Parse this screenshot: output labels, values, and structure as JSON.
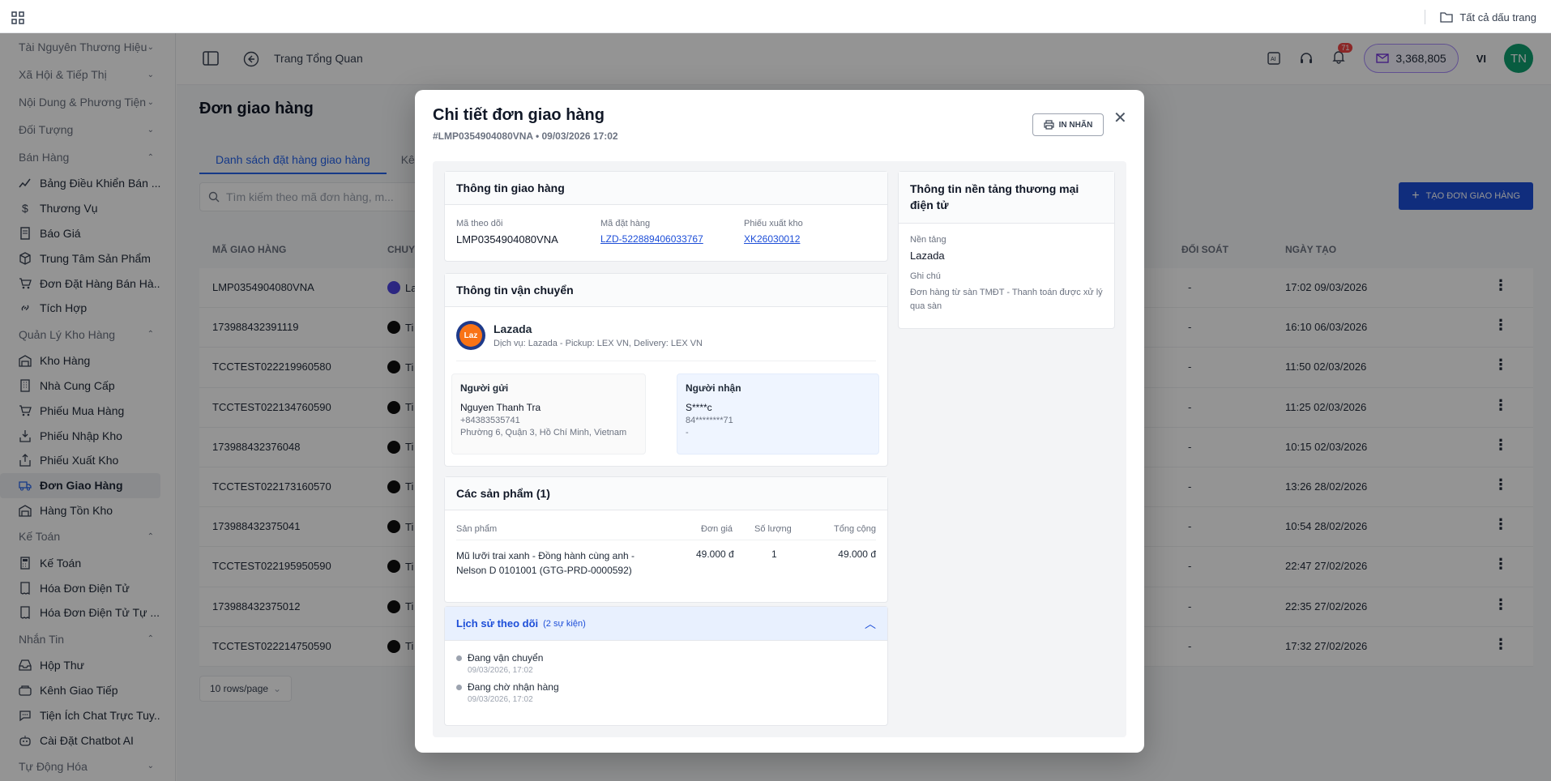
{
  "bookmarks": {
    "all_bookmarks": "Tất cả dấu trang"
  },
  "sidebar": {
    "groups": [
      {
        "type": "section",
        "label": "Tài Nguyên Thương Hiệu",
        "chev": "⌄"
      },
      {
        "type": "section",
        "label": "Xã Hội & Tiếp Thị",
        "chev": "⌄"
      },
      {
        "type": "section",
        "label": "Nội Dung & Phương Tiện",
        "chev": "⌄"
      },
      {
        "type": "section",
        "label": "Đối Tượng",
        "chev": "⌄"
      },
      {
        "type": "section",
        "label": "Bán Hàng",
        "chev": "⌃"
      },
      {
        "type": "item",
        "label": "Bảng Điều Khiển Bán ...",
        "icon": "chart-line-icon"
      },
      {
        "type": "item",
        "label": "Thương Vụ",
        "icon": "dollar-icon"
      },
      {
        "type": "item",
        "label": "Báo Giá",
        "icon": "document-icon"
      },
      {
        "type": "item",
        "label": "Trung Tâm Sản Phẩm",
        "icon": "box-icon"
      },
      {
        "type": "item",
        "label": "Đơn Đặt Hàng Bán Hà...",
        "icon": "cart-icon"
      },
      {
        "type": "item",
        "label": "Tích Hợp",
        "icon": "link-icon"
      },
      {
        "type": "section",
        "label": "Quản Lý Kho Hàng",
        "chev": "⌃"
      },
      {
        "type": "item",
        "label": "Kho Hàng",
        "icon": "warehouse-icon"
      },
      {
        "type": "item",
        "label": "Nhà Cung Cấp",
        "icon": "building-icon"
      },
      {
        "type": "item",
        "label": "Phiếu Mua Hàng",
        "icon": "cart-icon"
      },
      {
        "type": "item",
        "label": "Phiếu Nhập Kho",
        "icon": "import-icon"
      },
      {
        "type": "item",
        "label": "Phiếu Xuất Kho",
        "icon": "export-icon"
      },
      {
        "type": "item",
        "label": "Đơn Giao Hàng",
        "icon": "truck-icon",
        "active": true
      },
      {
        "type": "item",
        "label": "Hàng Tồn Kho",
        "icon": "warehouse-icon"
      },
      {
        "type": "section",
        "label": "Kế Toán",
        "chev": "⌃"
      },
      {
        "type": "item",
        "label": "Kế Toán",
        "icon": "calculator-icon"
      },
      {
        "type": "item",
        "label": "Hóa Đơn Điện Tử",
        "icon": "receipt-icon"
      },
      {
        "type": "item",
        "label": "Hóa Đơn Điện Tử Tự ...",
        "icon": "receipt-icon"
      },
      {
        "type": "section",
        "label": "Nhắn Tin",
        "chev": "⌃"
      },
      {
        "type": "item",
        "label": "Hộp Thư",
        "icon": "inbox-icon"
      },
      {
        "type": "item",
        "label": "Kênh Giao Tiếp",
        "icon": "channel-icon"
      },
      {
        "type": "item",
        "label": "Tiện Ích Chat Trực Tuy...",
        "icon": "chat-icon"
      },
      {
        "type": "item",
        "label": "Cài Đặt Chatbot AI",
        "icon": "bot-icon"
      },
      {
        "type": "section",
        "label": "Tự Động Hóa",
        "chev": "⌄"
      }
    ]
  },
  "topbar": {
    "breadcrumb": "Trang Tổng Quan",
    "notif_count": "71",
    "credits": "3,368,805",
    "lang": "VI",
    "avatar": "TN"
  },
  "page": {
    "title": "Đơn giao hàng",
    "tab_active": "Danh sách đặt hàng giao hàng",
    "tab_other": "Kê",
    "search_placeholder": "Tìm kiếm theo mã đơn hàng, m...",
    "create_button": "TẠO ĐƠN GIAO HÀNG",
    "col_code": "MÃ GIAO HÀNG",
    "col_carrier": "CHUYỂ",
    "col_reconcile": "ĐỐI SOÁT",
    "col_created": "NGÀY TẠO",
    "pager": "10 rows/page",
    "rows": [
      {
        "code": "LMP0354904080VNA",
        "carrier": "La",
        "reconcile": "-",
        "created": "17:02 09/03/2026"
      },
      {
        "code": "173988432391119",
        "carrier": "Ti",
        "reconcile": "-",
        "created": "16:10 06/03/2026"
      },
      {
        "code": "TCCTEST022219960580",
        "carrier": "Ti",
        "reconcile": "-",
        "created": "11:50 02/03/2026"
      },
      {
        "code": "TCCTEST022134760590",
        "carrier": "Ti",
        "reconcile": "-",
        "created": "11:25 02/03/2026"
      },
      {
        "code": "173988432376048",
        "carrier": "Ti",
        "reconcile": "-",
        "created": "10:15 02/03/2026"
      },
      {
        "code": "TCCTEST022173160570",
        "carrier": "Ti",
        "reconcile": "-",
        "created": "13:26 28/02/2026"
      },
      {
        "code": "173988432375041",
        "carrier": "Ti",
        "reconcile": "-",
        "created": "10:54 28/02/2026"
      },
      {
        "code": "TCCTEST022195950590",
        "carrier": "Ti",
        "reconcile": "-",
        "created": "22:47 27/02/2026"
      },
      {
        "code": "173988432375012",
        "carrier": "Ti",
        "reconcile": "-",
        "created": "22:35 27/02/2026"
      },
      {
        "code": "TCCTEST022214750590",
        "carrier": "Ti",
        "reconcile": "-",
        "created": "17:32 27/02/2026"
      }
    ]
  },
  "modal": {
    "title": "Chi tiết đơn giao hàng",
    "subtitle": "#LMP0354904080VNA  •  09/03/2026 17:02",
    "print_button": "IN NHÃN",
    "shipping_info": {
      "title": "Thông tin giao hàng",
      "tracking_label": "Mã theo dõi",
      "tracking_value": "LMP0354904080VNA",
      "order_label": "Mã đặt hàng",
      "order_value": "LZD-522889406033767",
      "export_label": "Phiếu xuất kho",
      "export_value": "XK26030012"
    },
    "transport": {
      "title": "Thông tin vận chuyển",
      "carrier_logo": "Laz",
      "carrier_name": "Lazada",
      "service": "Dịch vụ: Lazada - Pickup: LEX VN, Delivery: LEX VN",
      "sender_title": "Người gửi",
      "sender_name": "Nguyen Thanh Tra",
      "sender_phone": "+84383535741",
      "sender_address": "Phường 6, Quận 3, Hồ Chí Minh, Vietnam",
      "receiver_title": "Người nhận",
      "receiver_name": "S****c",
      "receiver_phone": "84********71",
      "receiver_address": "-"
    },
    "products": {
      "title": "Các sản phẩm (1)",
      "col_product": "Sản phẩm",
      "col_price": "Đơn giá",
      "col_qty": "Số lượng",
      "col_total": "Tổng cộng",
      "item_name": "Mũ lưỡi trai xanh - Đồng hành cùng anh - Nelson D 0101001 (GTG-PRD-0000592)",
      "item_price": "49.000 đ",
      "item_qty": "1",
      "item_total": "49.000 đ"
    },
    "history": {
      "title": "Lịch sử theo dõi",
      "count": "(2 sự kiện)",
      "events": [
        {
          "status": "Đang vận chuyển",
          "time": "09/03/2026, 17:02"
        },
        {
          "status": "Đang chờ nhận hàng",
          "time": "09/03/2026, 17:02"
        }
      ]
    },
    "platform": {
      "title": "Thông tin nền tảng thương mại điện tử",
      "platform_label": "Nền tảng",
      "platform_value": "Lazada",
      "note_label": "Ghi chú",
      "note_value": "Đơn hàng từ sàn TMĐT - Thanh toán được xử lý qua sàn"
    }
  },
  "colors": {
    "accent": "#1d4ed8",
    "active_bg": "#eef0f3",
    "overlay": "rgba(0,0,0,0.42)"
  }
}
